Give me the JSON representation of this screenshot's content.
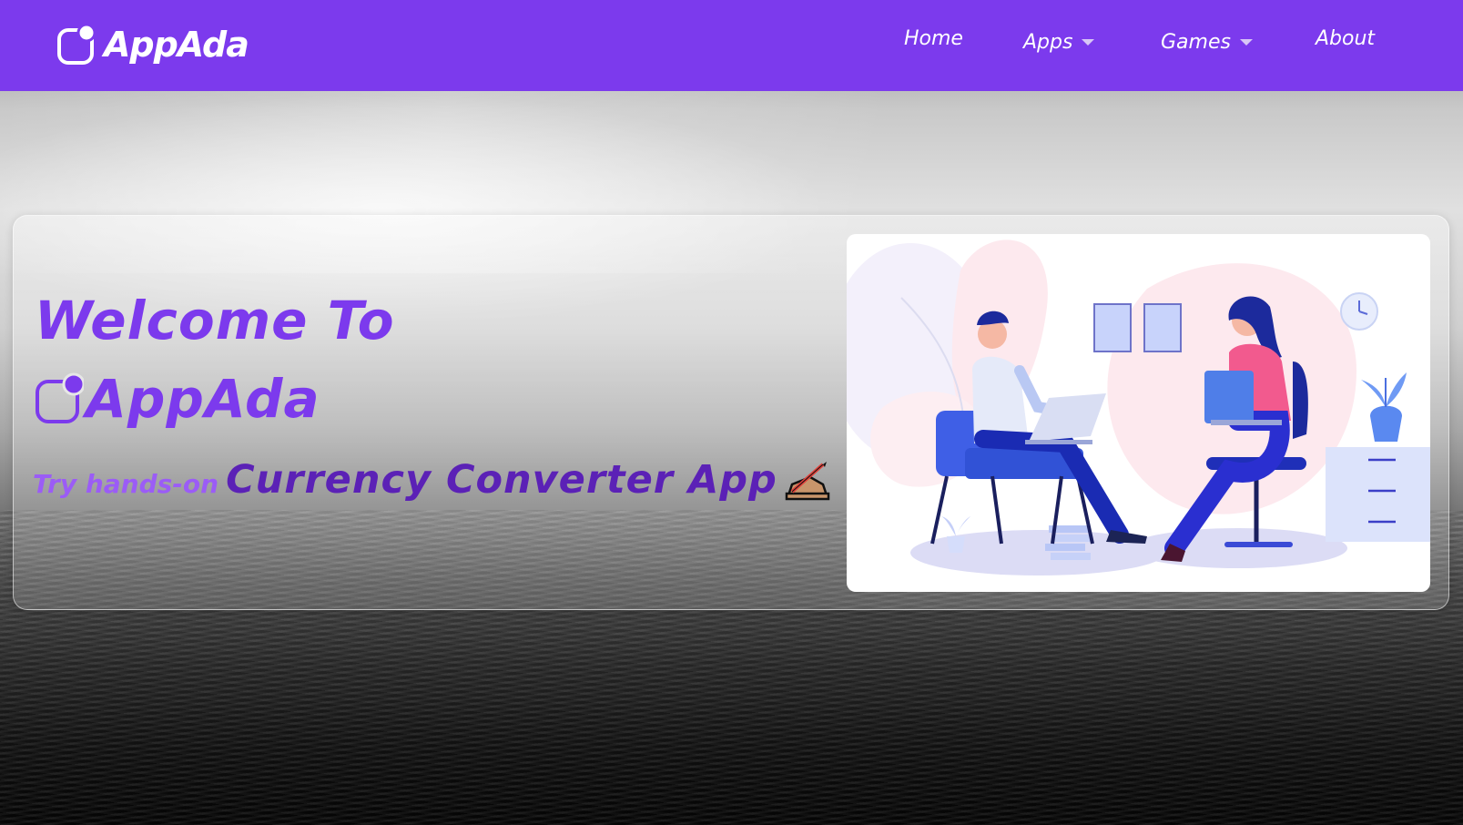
{
  "navbar": {
    "brand": "AppAda",
    "items": [
      {
        "label": "Home",
        "has_dropdown": false
      },
      {
        "label": "Apps",
        "has_dropdown": true
      },
      {
        "label": "Games",
        "has_dropdown": true
      },
      {
        "label": "About",
        "has_dropdown": false
      }
    ],
    "background_color": "#7c3aed"
  },
  "hero": {
    "welcome": "Welcome To",
    "brand": "AppAda",
    "tagline_prefix": "Try hands-on",
    "tagline_app": "Currency Converter App",
    "tagline_icon": "writing-hand-icon",
    "illustration": "office-meeting-illustration",
    "accent_color": "#7c3aed"
  }
}
